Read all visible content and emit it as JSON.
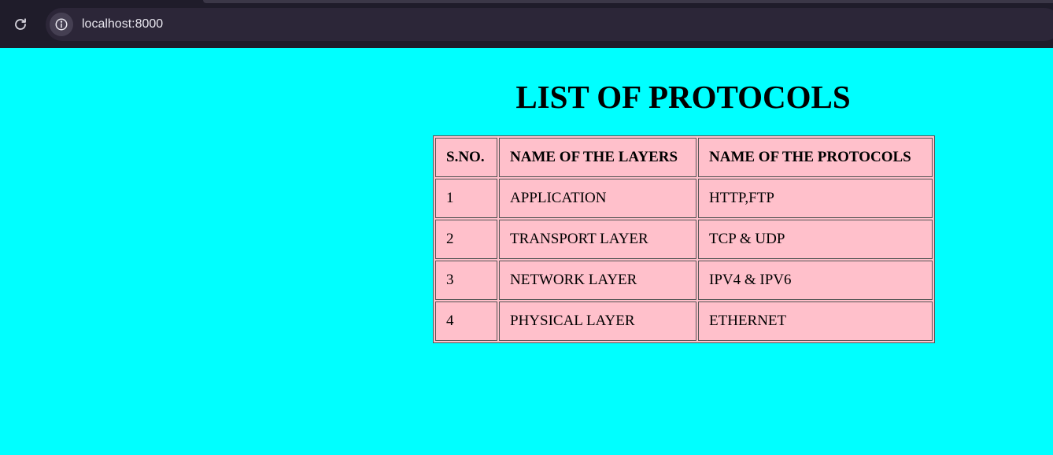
{
  "browser": {
    "url": "localhost:8000"
  },
  "page": {
    "title": "LIST OF PROTOCOLS",
    "background": "#00ffff",
    "table_background": "#ffc0cb",
    "table": {
      "headers": [
        "S.NO.",
        "NAME OF THE LAYERS",
        "NAME OF THE PROTOCOLS"
      ],
      "rows": [
        [
          "1",
          "APPLICATION",
          "HTTP,FTP"
        ],
        [
          "2",
          "TRANSPORT LAYER",
          "TCP & UDP"
        ],
        [
          "3",
          "NETWORK LAYER",
          "IPV4 & IPV6"
        ],
        [
          "4",
          "PHYSICAL LAYER",
          "ETHERNET"
        ]
      ]
    }
  }
}
